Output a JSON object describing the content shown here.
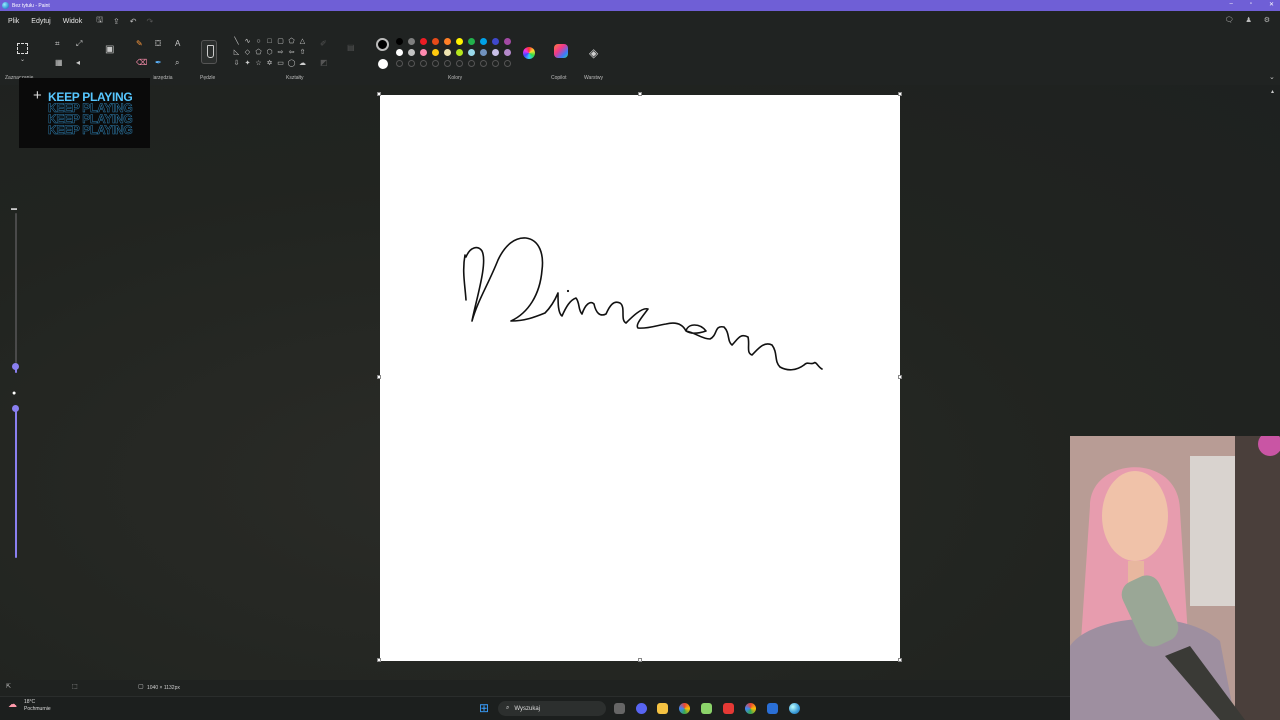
{
  "window": {
    "title": "Bez tytułu - Paint"
  },
  "menu": {
    "items": [
      "Plik",
      "Edytuj",
      "Widok"
    ]
  },
  "ribbon": {
    "groups": {
      "selection": "Zaznaczanie",
      "tools": "Narzędzia",
      "brushes": "Pędzle",
      "shapes": "Kształty",
      "colors": "Kolory",
      "copilot": "Copilot",
      "layers": "Warstwy"
    },
    "palette": [
      "#000000",
      "#7f7f7f",
      "#ed1c24",
      "#e64a19",
      "#ff7f27",
      "#fff200",
      "#22b14c",
      "#00a2e8",
      "#3f48cc",
      "#a349a4",
      "#ffffff",
      "#c3c3c3",
      "#ff8ab0",
      "#ffc90e",
      "#efe4b0",
      "#b5e61d",
      "#99d9ea",
      "#7092be",
      "#c8bfe7",
      "#b58acb",
      "",
      "",
      "",
      "",
      "",
      "",
      "",
      "",
      "",
      ""
    ],
    "primary_color": "#000000",
    "secondary_color": "#ffffff"
  },
  "overlay_logo": {
    "text": "KEEP PLAYING"
  },
  "status": {
    "canvas_size": "1040 × 1132px"
  },
  "taskbar": {
    "search_placeholder": "Wyszukaj",
    "weather_temp": "18°C",
    "weather_desc": "Pochmurnie"
  },
  "accent": "#6f5fd6"
}
